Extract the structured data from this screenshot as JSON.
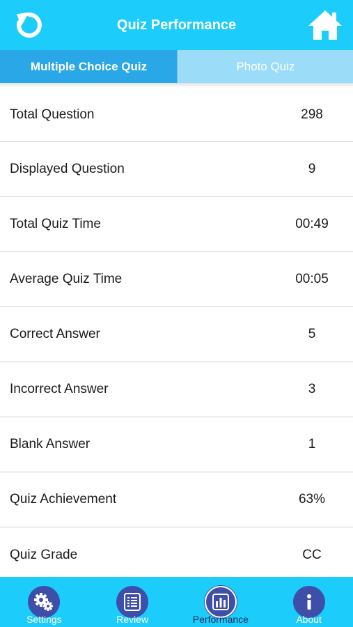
{
  "header": {
    "title": "Quiz Performance"
  },
  "tabs": [
    {
      "label": "Multiple Choice Quiz"
    },
    {
      "label": "Photo Quiz"
    }
  ],
  "stats": [
    {
      "label": "Total Question",
      "value": "298"
    },
    {
      "label": "Displayed Question",
      "value": "9"
    },
    {
      "label": "Total Quiz Time",
      "value": "00:49"
    },
    {
      "label": "Average Quiz Time",
      "value": "00:05"
    },
    {
      "label": "Correct Answer",
      "value": "5"
    },
    {
      "label": "Incorrect Answer",
      "value": "3"
    },
    {
      "label": "Blank Answer",
      "value": "1"
    },
    {
      "label": "Quiz Achievement",
      "value": "63%"
    },
    {
      "label": "Quiz Grade",
      "value": "CC"
    }
  ],
  "tabbar": [
    {
      "label": "Settings",
      "icon": "gears-icon"
    },
    {
      "label": "Review",
      "icon": "list-icon"
    },
    {
      "label": "Performance",
      "icon": "bar-chart-icon"
    },
    {
      "label": "About",
      "icon": "info-icon"
    }
  ],
  "colors": {
    "header_bg": "#1ccdfb",
    "tab_active": "#2aa7e6",
    "tab_inactive": "#9bdcf9",
    "tabbar_icon_bg": "#3d4fa8"
  }
}
